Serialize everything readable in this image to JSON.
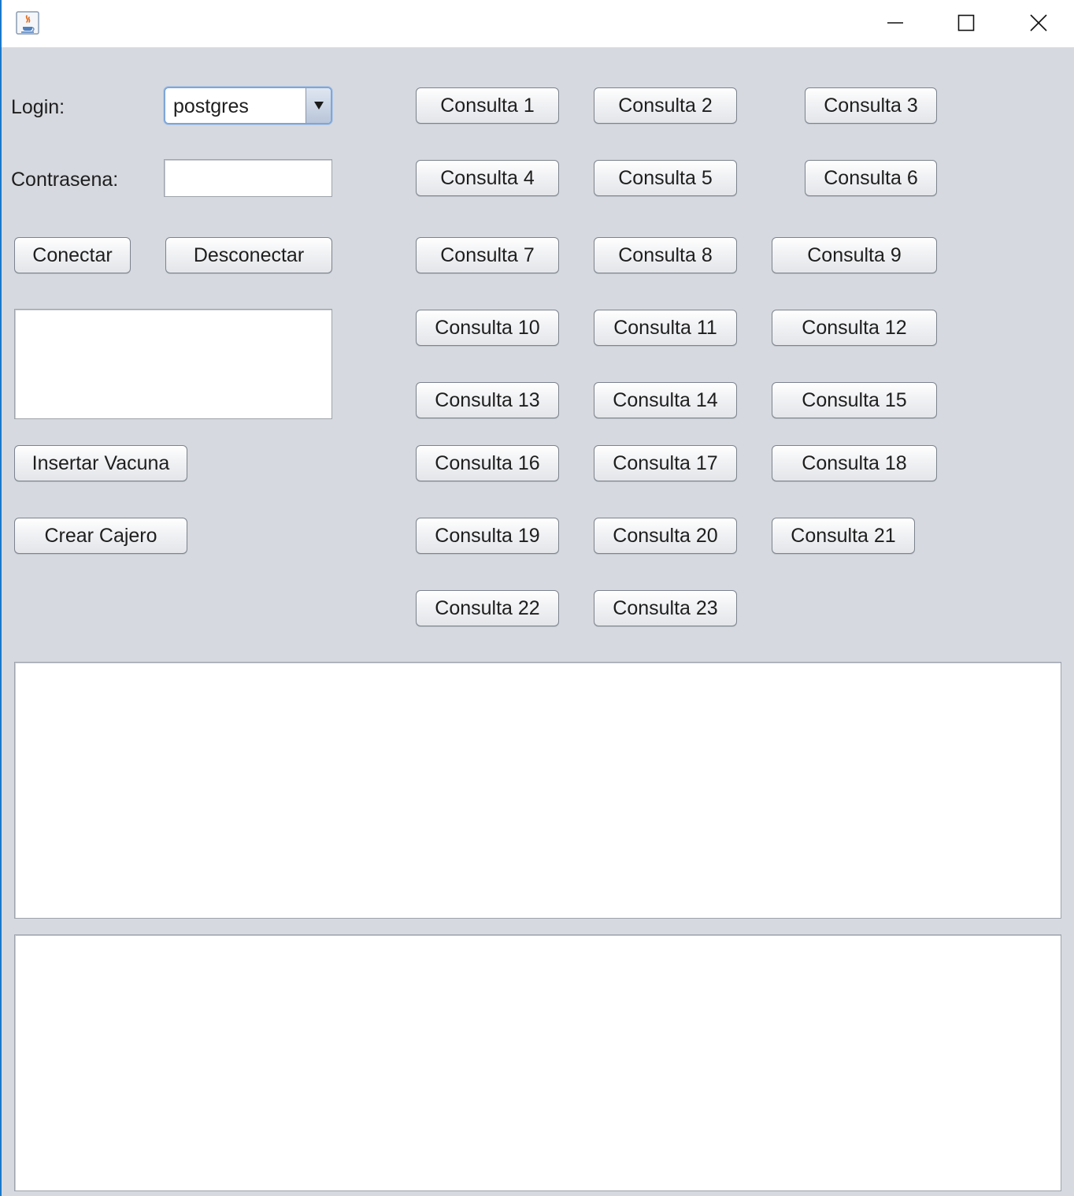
{
  "window": {
    "title": "",
    "controls": {
      "minimize": "minimize-icon",
      "maximize": "maximize-icon",
      "close": "close-icon"
    },
    "icon": "java-cup-icon"
  },
  "form": {
    "login_label": "Login:",
    "login_selected": "postgres",
    "password_label": "Contrasena:",
    "password_value": "",
    "connect_button": "Conectar",
    "disconnect_button": "Desconectar",
    "status_text": "",
    "insert_vaccine_button": "Insertar Vacuna",
    "create_cashier_button": "Crear Cajero"
  },
  "queries": [
    "Consulta 1",
    "Consulta 2",
    "Consulta 3",
    "Consulta 4",
    "Consulta 5",
    "Consulta 6",
    "Consulta 7",
    "Consulta 8",
    "Consulta 9",
    "Consulta 10",
    "Consulta 11",
    "Consulta 12",
    "Consulta 13",
    "Consulta 14",
    "Consulta 15",
    "Consulta 16",
    "Consulta 17",
    "Consulta 18",
    "Consulta 19",
    "Consulta 20",
    "Consulta 21",
    "Consulta 22",
    "Consulta 23"
  ],
  "output": {
    "results_text": "",
    "log_text": ""
  },
  "colors": {
    "background": "#d6d9df",
    "accent": "#1979ca",
    "combo_focus": "#7fa6d6"
  }
}
